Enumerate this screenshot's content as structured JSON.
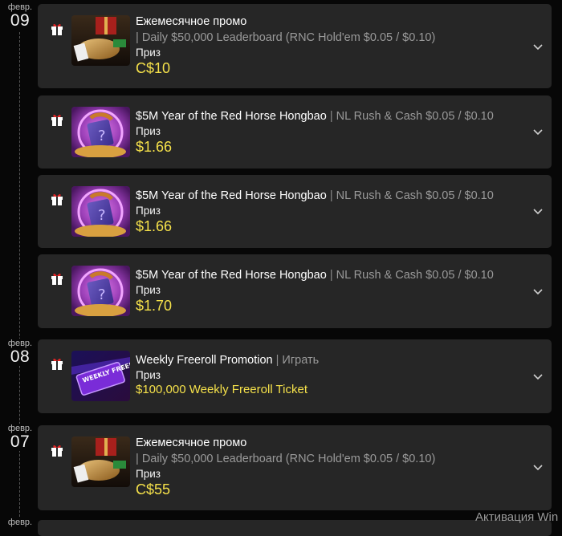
{
  "dates": [
    {
      "month": "февр.",
      "day": "09"
    },
    {
      "month": "февр.",
      "day": "08"
    },
    {
      "month": "февр.",
      "day": "07"
    },
    {
      "month": "февр."
    }
  ],
  "cards": [
    {
      "title": "Ежемесячное промо",
      "subtitle": "Daily $50,000 Leaderboard (RNC Hold'em $0.05 / $0.10)",
      "prize_label": "Приз",
      "prize": "C$10"
    },
    {
      "title": "$5M Year of the Red Horse Hongbao",
      "subtitle": "NL Rush & Cash $0.05 / $0.10",
      "prize_label": "Приз",
      "prize": "$1.66"
    },
    {
      "title": "$5M Year of the Red Horse Hongbao",
      "subtitle": "NL Rush & Cash $0.05 / $0.10",
      "prize_label": "Приз",
      "prize": "$1.66"
    },
    {
      "title": "$5M Year of the Red Horse Hongbao",
      "subtitle": "NL Rush & Cash $0.05 / $0.10",
      "prize_label": "Приз",
      "prize": "$1.70"
    },
    {
      "title": "Weekly Freeroll Promotion",
      "subtitle": "Играть",
      "prize_label": "Приз",
      "prize": "$100,000 Weekly Freeroll Ticket",
      "thumb_text": "WEEKLY FREEROLL"
    },
    {
      "title": "Ежемесячное промо",
      "subtitle": "Daily $50,000 Leaderboard (RNC Hold'em $0.05 / $0.10)",
      "prize_label": "Приз",
      "prize": "C$55"
    }
  ],
  "separator": "|",
  "watermark": "Активация Win",
  "colors": {
    "prize": "#f5e14a",
    "card": "#262626",
    "background": "#070707"
  },
  "icons": {
    "gift": "gift-icon",
    "expand": "chevron-down-icon"
  }
}
